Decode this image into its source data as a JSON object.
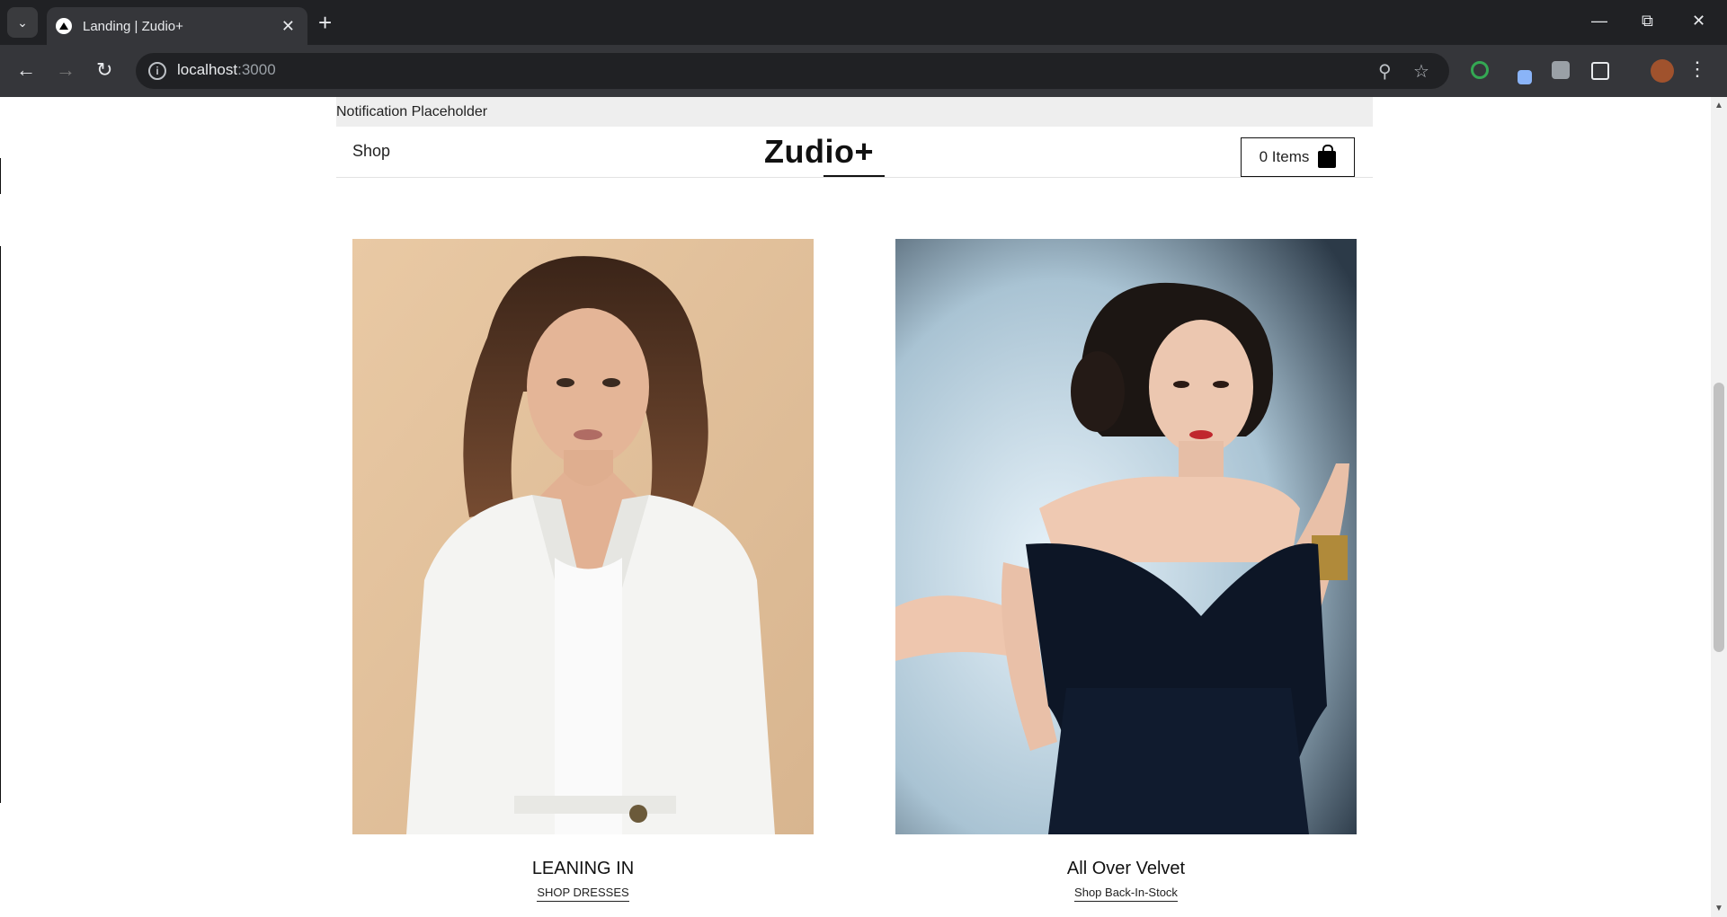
{
  "browser": {
    "tab_title": "Landing | Zudio+",
    "url_host": "localhost",
    "url_port": ":3000"
  },
  "page": {
    "notification": "Notification Placeholder",
    "nav_shop": "Shop",
    "logo": "Zudio+",
    "cart_label": "0 Items"
  },
  "cards": [
    {
      "title": "LEANING IN",
      "link": "SHOP DRESSES",
      "image": "woman in white blazer on tan background"
    },
    {
      "title": "All Over Velvet",
      "link": "Shop Back-In-Stock",
      "image": "woman in navy off-shoulder dress on blue background"
    }
  ],
  "colors": {
    "chrome_dark": "#202124",
    "chrome_toolbar": "#35363a",
    "notification_bg": "#eeeeee"
  }
}
